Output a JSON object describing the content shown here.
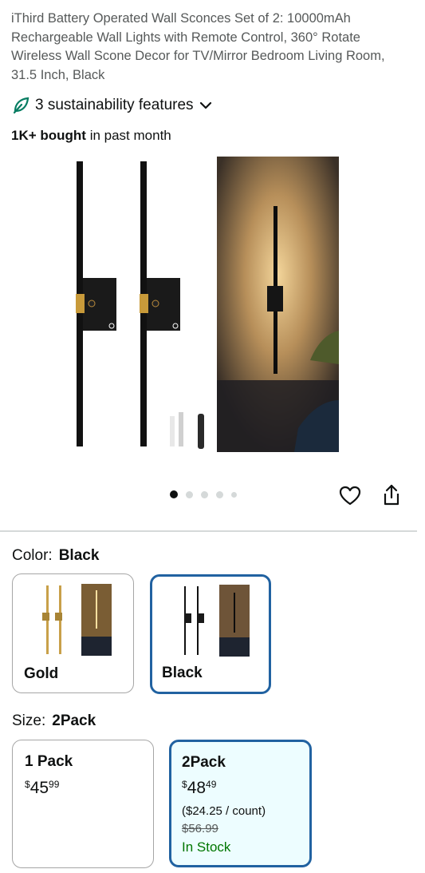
{
  "product": {
    "title": "iThird Battery Operated Wall Sconces Set of 2: 10000mAh Rechargeable Wall Lights with Remote Control, 360° Rotate Wireless Wall Scone Decor for TV/Mirror Bedroom Living Room, 31.5 Inch, Black",
    "sustainability": "3 sustainability features",
    "bought_count": "1K+ bought",
    "bought_suffix": " in past month"
  },
  "gallery": {
    "dots_total": 5,
    "active_index": 0
  },
  "icons": {
    "leaf": "leaf-icon",
    "chevron": "chevron-down-icon",
    "heart": "heart-icon",
    "share": "share-icon"
  },
  "color": {
    "label": "Color:",
    "selected": "Black",
    "options": [
      {
        "name": "Gold"
      },
      {
        "name": "Black"
      }
    ]
  },
  "size": {
    "label": "Size:",
    "selected": "2Pack",
    "options": [
      {
        "name": "1 Pack",
        "price_symbol": "$",
        "price_whole": "45",
        "price_fraction": "99"
      },
      {
        "name": "2Pack",
        "price_symbol": "$",
        "price_whole": "48",
        "price_fraction": "49",
        "unit_price": "($24.25 / count)",
        "list_price": "$56.99",
        "availability": "In Stock"
      }
    ]
  },
  "colors": {
    "accent_border": "#2162a1",
    "selected_bg": "#edfdff",
    "in_stock": "#007600",
    "muted_text": "#565959"
  }
}
